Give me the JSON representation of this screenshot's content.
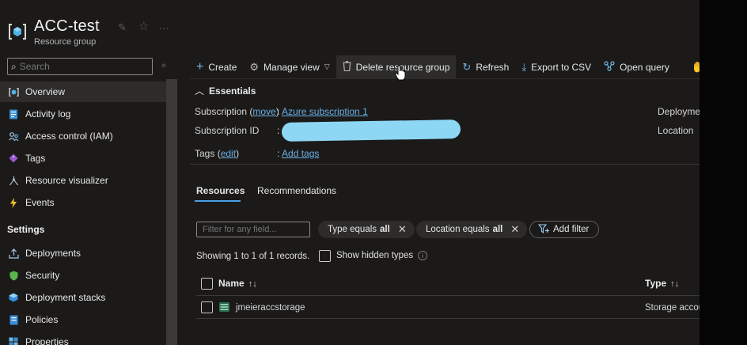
{
  "header": {
    "title": "ACC-test",
    "subtitle": "Resource group"
  },
  "sidebar": {
    "search_placeholder": "Search",
    "items": [
      {
        "label": "Overview",
        "icon": "resource-group-icon"
      },
      {
        "label": "Activity log",
        "icon": "activity-log-icon"
      },
      {
        "label": "Access control (IAM)",
        "icon": "people-icon"
      },
      {
        "label": "Tags",
        "icon": "tag-icon"
      },
      {
        "label": "Resource visualizer",
        "icon": "visualizer-icon"
      },
      {
        "label": "Events",
        "icon": "lightning-icon"
      }
    ],
    "settings_label": "Settings",
    "settings_items": [
      {
        "label": "Deployments",
        "icon": "deploy-icon"
      },
      {
        "label": "Security",
        "icon": "shield-icon"
      },
      {
        "label": "Deployment stacks",
        "icon": "stack-icon"
      },
      {
        "label": "Policies",
        "icon": "policy-icon"
      },
      {
        "label": "Properties",
        "icon": "properties-icon"
      }
    ]
  },
  "toolbar": {
    "create": "Create",
    "manage_view": "Manage view",
    "delete": "Delete resource group",
    "refresh": "Refresh",
    "export": "Export to CSV",
    "open_query": "Open query"
  },
  "essentials": {
    "heading": "Essentials",
    "subscription_label": "Subscription",
    "move_link": "move",
    "subscription_value": "Azure subscription 1",
    "subscription_id_label": "Subscription ID",
    "tags_label": "Tags",
    "edit_link": "edit",
    "add_tags": "Add tags",
    "deployments_label": "Deployme",
    "location_label": "Location"
  },
  "tabs": {
    "resources": "Resources",
    "recommendations": "Recommendations"
  },
  "filters": {
    "placeholder": "Filter for any field...",
    "type_prefix": "Type equals",
    "type_value": "all",
    "location_prefix": "Location equals",
    "location_value": "all",
    "add_filter": "Add filter"
  },
  "list": {
    "records_text": "Showing 1 to 1 of 1 records.",
    "show_hidden": "Show hidden types",
    "col_name": "Name",
    "col_type": "Type",
    "rows": [
      {
        "name": "jmeieraccstorage",
        "type": "Storage accou"
      }
    ]
  },
  "colors": {
    "background": "#1b1a19",
    "link": "#69afe5",
    "accent": "#4aa1e8"
  }
}
